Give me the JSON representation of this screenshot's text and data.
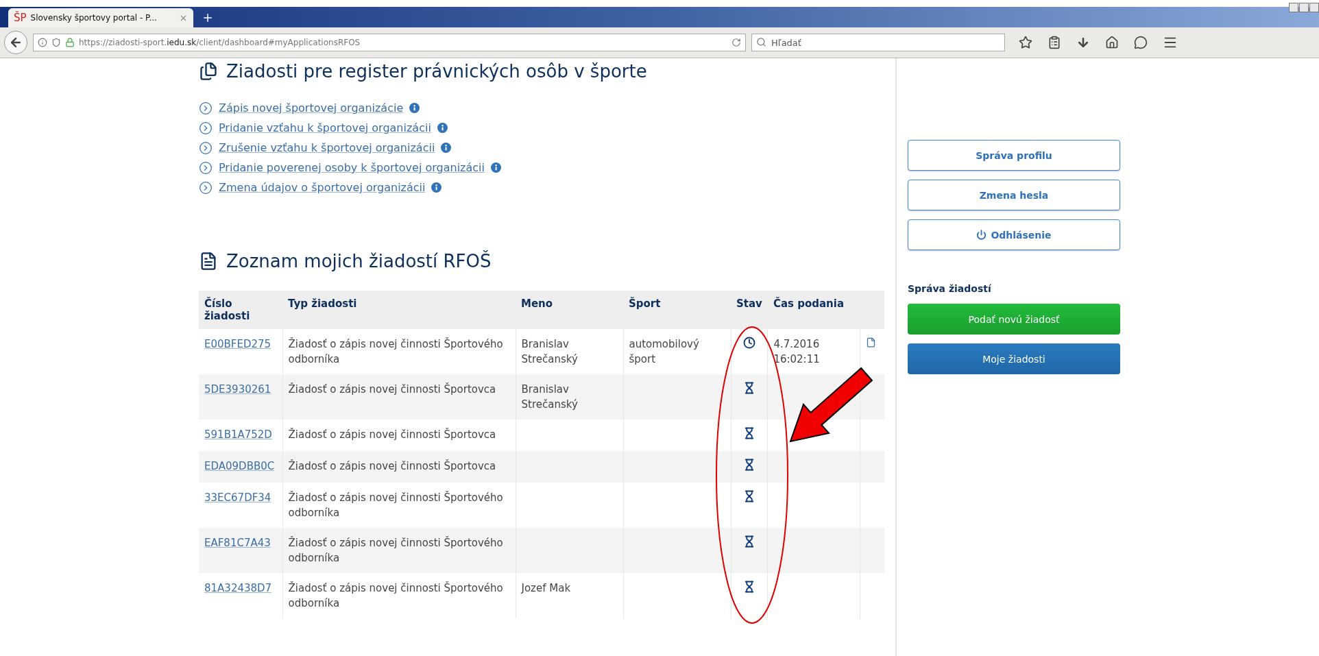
{
  "browser": {
    "tab": {
      "favicon": "ŠP",
      "title": "Slovensky športovy portal - P..."
    },
    "url": "https://ziadosti-sport.**iedu.sk**/client/dashboard#myApplicationsRFOS",
    "search": {
      "placeholder": "Hľadať"
    }
  },
  "section_title": "Ziadosti pre register právnických osôb v športe",
  "links": [
    "Zápis novej športovej organizácie",
    "Pridanie vzťahu k športovej organizácii",
    "Zrušenie vzťahu k športovej organizácii",
    "Pridanie poverenej osoby k športovej organizácii",
    "Zmena údajov o športovej organizácii"
  ],
  "list_title": "Zoznam mojich žiadostí RFOŠ",
  "table": {
    "columns": [
      "Číslo žiadosti",
      "Typ žiadosti",
      "Meno",
      "Šport",
      "Stav",
      "Čas podania"
    ],
    "rows": [
      {
        "id": "E00BFED275",
        "type": "Žiadosť o zápis novej činnosti Športového odborníka",
        "name": "Branislav Strečanský",
        "sport": "automobilový šport",
        "kind": "clock",
        "time": "4.7.2016 16:02:11",
        "pdf": true
      },
      {
        "id": "5DE3930261",
        "type": "Žiadosť o zápis novej činnosti Športovca",
        "name": "Branislav Strečanský",
        "kind": "hourglass",
        "pdf": false
      },
      {
        "id": "591B1A752D",
        "type": "Žiadosť o zápis novej činnosti Športovca",
        "kind": "hourglass",
        "pdf": false
      },
      {
        "id": "EDA09DBB0C",
        "type": "Žiadosť o zápis novej činnosti Športovca",
        "kind": "hourglass",
        "pdf": false
      },
      {
        "id": "33EC67DF34",
        "type": "Žiadosť o zápis novej činnosti Športového odborníka",
        "kind": "hourglass",
        "pdf": false
      },
      {
        "id": "EAF81C7A43",
        "type": "Žiadosť o zápis novej činnosti Športového odborníka",
        "kind": "hourglass",
        "pdf": false
      },
      {
        "id": "81A32438D7",
        "type": "Žiadosť o zápis novej činnosti Športového odborníka",
        "name": "Jozef Mak",
        "kind": "hourglass",
        "pdf": false
      }
    ]
  },
  "sidebar": {
    "buttons": [
      {
        "label": "Správa profilu",
        "kind": "outline"
      },
      {
        "label": "Zmena hesla",
        "kind": "outline"
      },
      {
        "label": "Odhlásenie",
        "kind": "logout"
      }
    ],
    "section_title": "Správa žiadostí",
    "actions": [
      {
        "label": "Podať novú žiadosť",
        "kind": "success"
      },
      {
        "label": "Moje žiadosti",
        "kind": "primary"
      }
    ]
  }
}
